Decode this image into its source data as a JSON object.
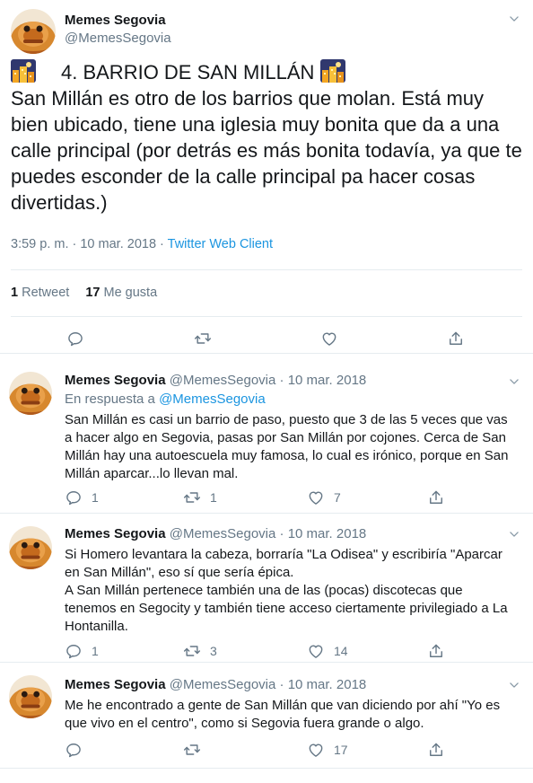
{
  "main_tweet": {
    "author_name": "Memes Segovia",
    "author_handle": "@MemesSegovia",
    "title": "4. BARRIO DE SAN MILLÁN",
    "body": "San Millán es otro de los barrios que molan. Está muy bien ubicado, tiene una iglesia muy bonita que da a una calle principal (por detrás es más bonita todavía, ya que te puedes esconder de la calle principal pa hacer cosas divertidas.)",
    "timestamp": "3:59 p. m. · 10 mar. 2018 · ",
    "client": "Twitter Web Client",
    "retweets_count": "1",
    "retweets_label": "Retweet",
    "likes_count": "17",
    "likes_label": "Me gusta"
  },
  "replies": [
    {
      "author_name": "Memes Segovia",
      "author_handle": "@MemesSegovia",
      "date": "10 mar. 2018",
      "in_reply_label": "En respuesta a ",
      "in_reply_mention": "@MemesSegovia",
      "lines": [
        "San Millán es casi un barrio de paso, puesto que 3 de las 5 veces que vas a hacer algo en Segovia, pasas por San Millán por cojones. Cerca de San Millán hay una autoescuela muy famosa, lo cual es irónico, porque en San Millán aparcar...lo llevan mal."
      ],
      "replies_count": "1",
      "retweets_count": "1",
      "likes_count": "7"
    },
    {
      "author_name": "Memes Segovia",
      "author_handle": "@MemesSegovia",
      "date": "10 mar. 2018",
      "lines": [
        "Si Homero levantara la cabeza, borraría \"La Odisea\" y escribiría \"Aparcar en San Millán\", eso sí que sería épica.",
        "A San Millán pertenece también una de las (pocas) discotecas que tenemos en Segocity y también tiene acceso ciertamente privilegiado a La Hontanilla."
      ],
      "replies_count": "1",
      "retweets_count": "3",
      "likes_count": "14"
    },
    {
      "author_name": "Memes Segovia",
      "author_handle": "@MemesSegovia",
      "date": "10 mar. 2018",
      "lines": [
        "Me he encontrado a gente de San Millán que van diciendo por ahí \"Yo es que vivo en el centro\", como si Segovia fuera grande o algo."
      ],
      "likes_count": "17"
    }
  ],
  "separator": " · ",
  "icons": {
    "reply": "speech-bubble-icon",
    "retweet": "retweet-arrows-icon",
    "like": "heart-icon",
    "share": "share-arrow-icon",
    "caret": "chevron-down-icon",
    "emoji": "night-city-emoji"
  },
  "colors": {
    "text": "#14171a",
    "muted": "#657786",
    "link": "#1b95e0",
    "divider": "#e6ecf0"
  }
}
